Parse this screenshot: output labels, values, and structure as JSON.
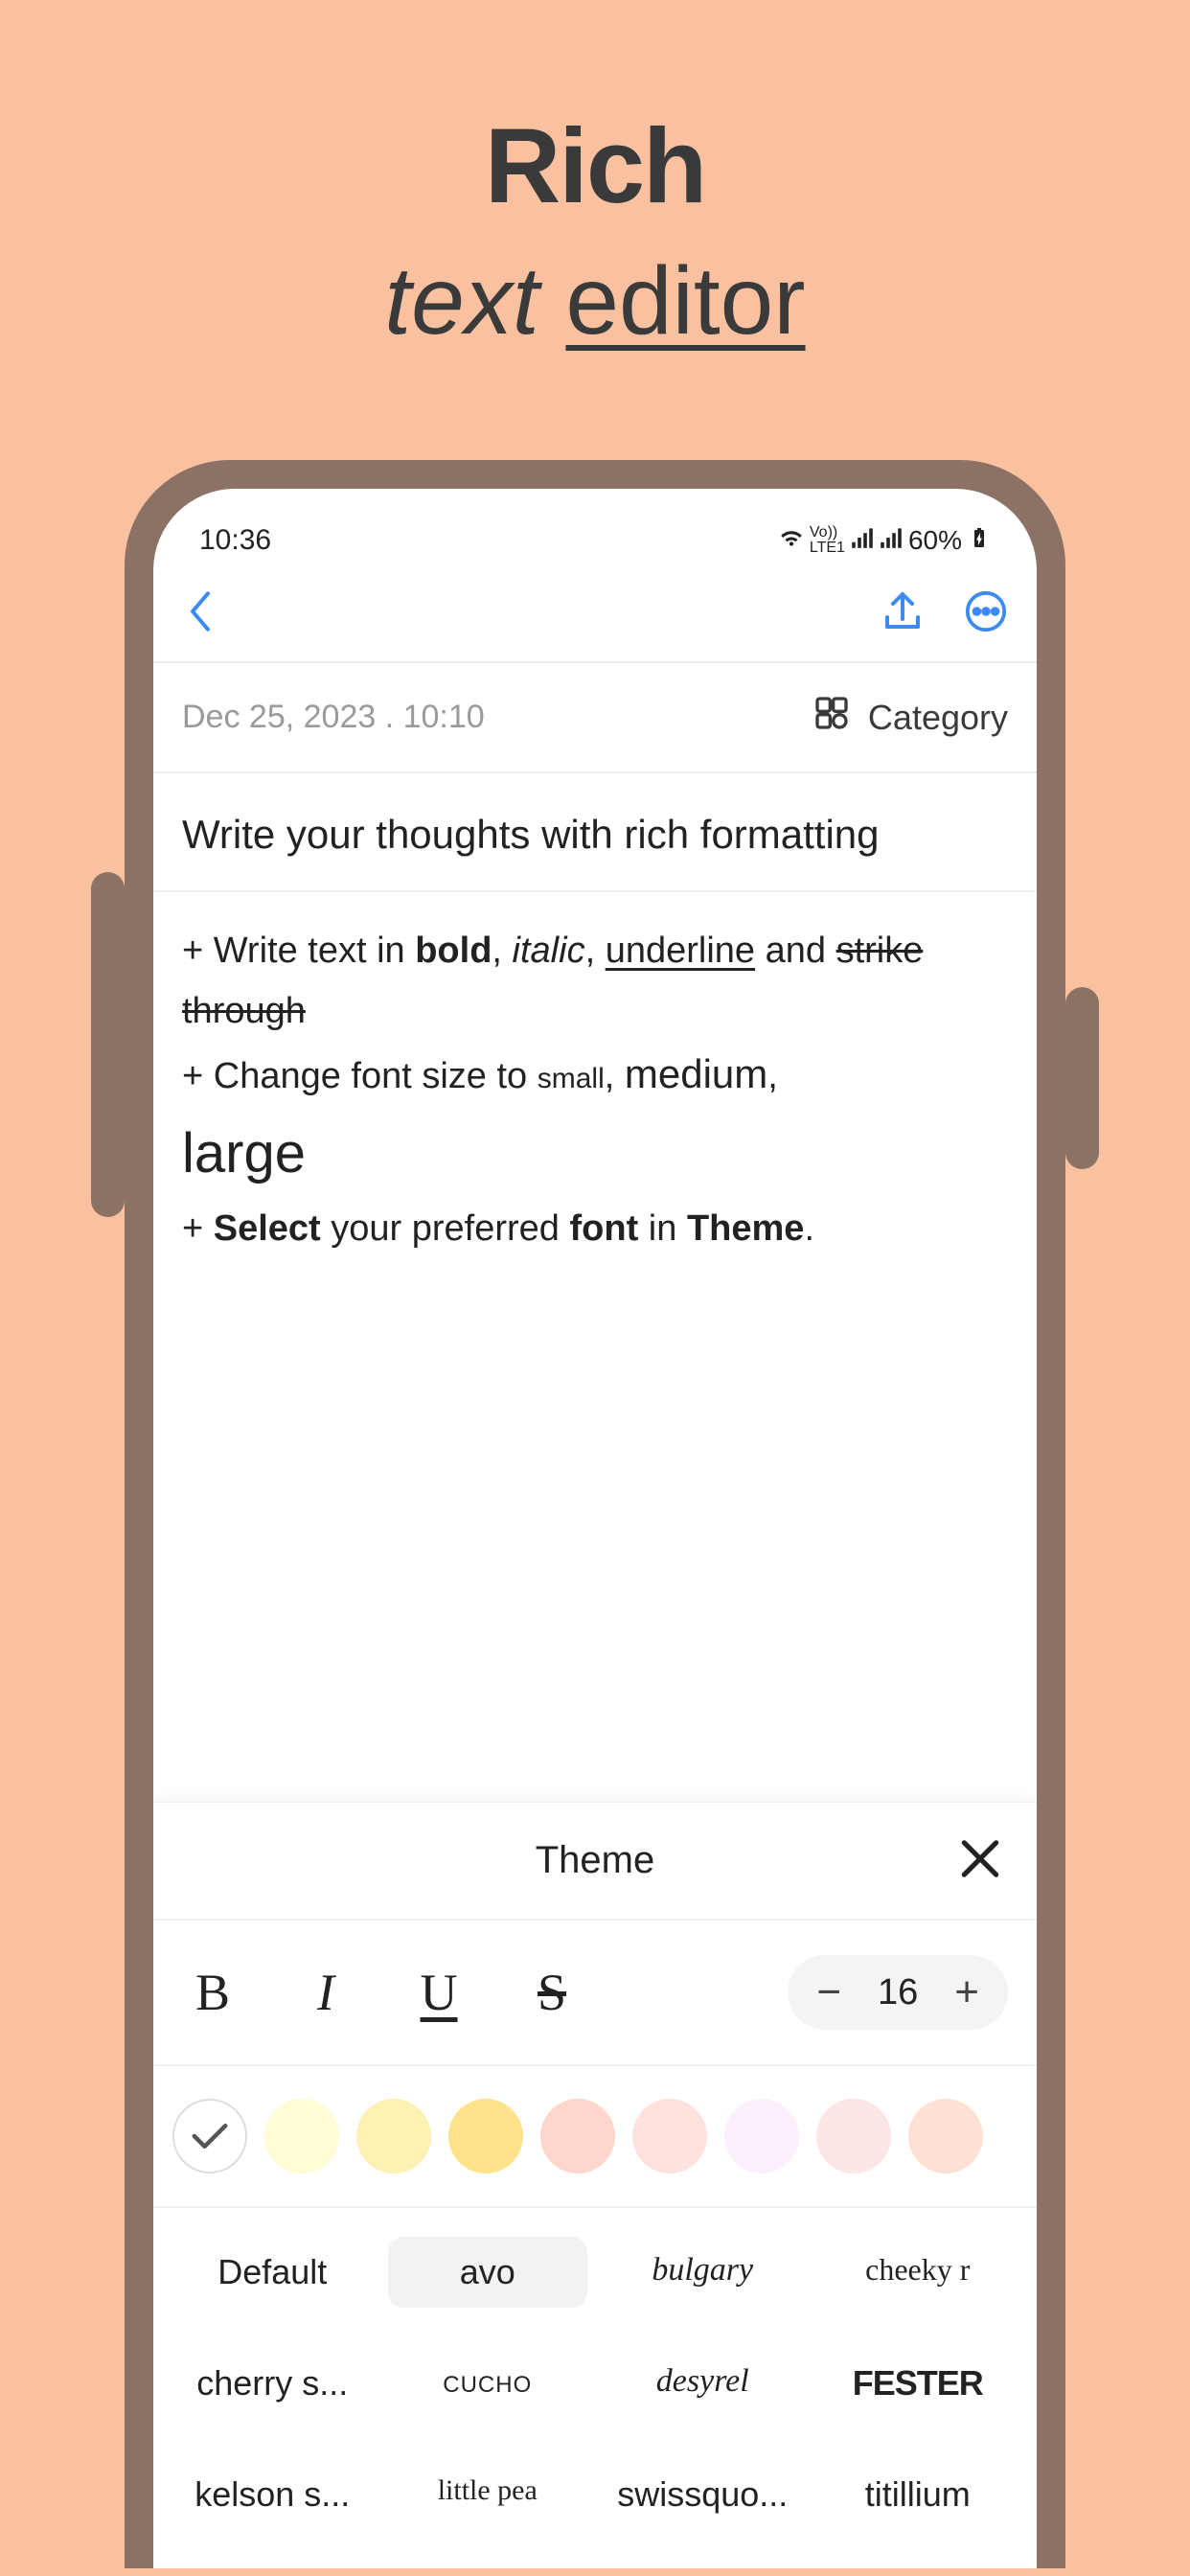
{
  "promo": {
    "line1": "Rich",
    "line2_italic": "text",
    "line2_underline": "editor"
  },
  "status": {
    "time": "10:36",
    "network_label": "LTE1",
    "vo_label": "Vo))",
    "battery": "60%"
  },
  "nav": {
    "back": "Back",
    "share": "Share",
    "more": "More"
  },
  "meta": {
    "timestamp": "Dec 25, 2023 . 10:10",
    "category_label": "Category"
  },
  "note": {
    "title": "Write your thoughts with rich formatting",
    "line1_prefix": "+ Write text in ",
    "bold": "bold",
    "sep_comma": ", ",
    "italic": "italic",
    "underline": "underline",
    "and": " and ",
    "strike": "strike through",
    "line2_prefix": "+ Change font size to ",
    "small": "small",
    "medium": "medium",
    "large": "large",
    "line3_prefix": "+ ",
    "select": "Select",
    "line3_mid": " your preferred ",
    "font_word": "font",
    "line3_mid2": " in ",
    "theme_word": "Theme",
    "period": "."
  },
  "theme": {
    "title": "Theme",
    "close": "Close",
    "bold_btn": "B",
    "italic_btn": "I",
    "underline_btn": "U",
    "strike_btn": "S",
    "minus": "−",
    "plus": "+",
    "font_size": "16",
    "colors": [
      "#FFFFFF",
      "#FFFCD6",
      "#FFF0B3",
      "#FFE28A",
      "#FFD6CC",
      "#FFE2DE",
      "#FBF0FC",
      "#FFE6E6",
      "#FFE0D5"
    ],
    "fonts": [
      "Default",
      "avo",
      "bulgary",
      "cheeky r",
      "cherry s...",
      "cucho",
      "desyrel",
      "FESTER",
      "kelson s...",
      "little pea",
      "swissquo...",
      "titillium"
    ],
    "selected_font_index": 1
  }
}
